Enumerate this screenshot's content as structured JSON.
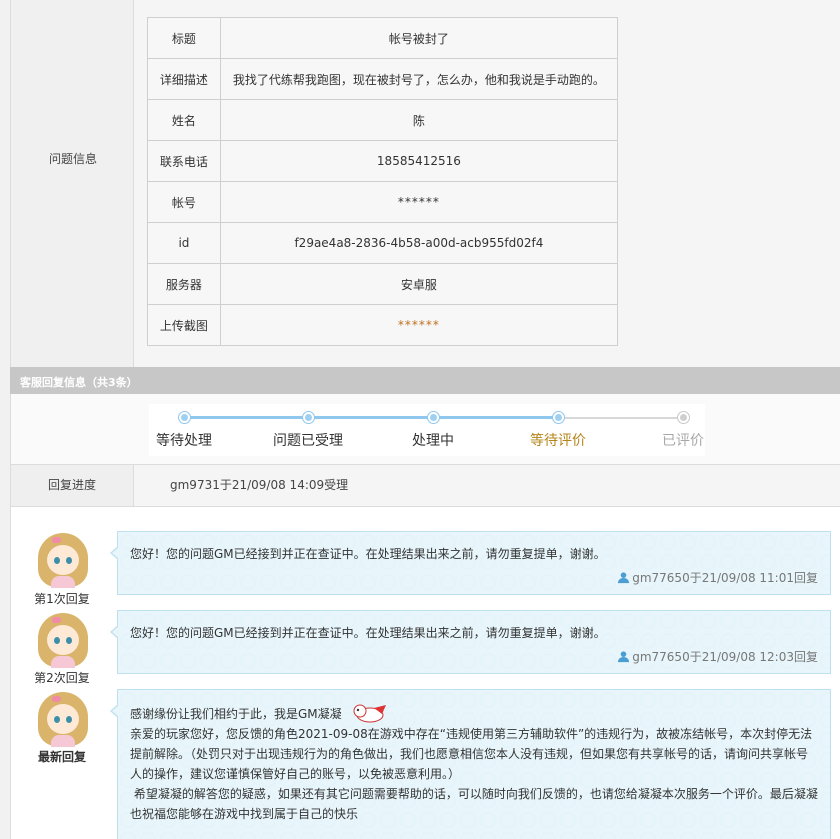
{
  "problem_info": {
    "section_label": "问题信息",
    "rows": [
      {
        "key": "标题",
        "value": "帐号被封了"
      },
      {
        "key": "详细描述",
        "value": "我找了代练帮我跑图，现在被封号了，怎么办，他和我说是手动跑的。"
      },
      {
        "key": "姓名",
        "value": "陈"
      },
      {
        "key": "联系电话",
        "value": "18585412516"
      },
      {
        "key": "帐号",
        "value": "******"
      },
      {
        "key": "id",
        "value": "f29ae4a8-2836-4b58-a00d-acb955fd02f4"
      },
      {
        "key": "服务器",
        "value": "安卓服"
      },
      {
        "key": "上传截图",
        "value": "******"
      }
    ]
  },
  "reply_header": "客服回复信息（共3条）",
  "progress_steps": [
    {
      "label": "等待处理",
      "state": "done"
    },
    {
      "label": "问题已受理",
      "state": "done"
    },
    {
      "label": "处理中",
      "state": "done"
    },
    {
      "label": "等待评价",
      "state": "current"
    },
    {
      "label": "已评价",
      "state": "pending"
    }
  ],
  "reply_progress": {
    "label": "回复进度",
    "value": "gm9731于21/09/08 14:09受理"
  },
  "replies": [
    {
      "label": "第1次回复",
      "message": "您好！您的问题GM已经接到并正在查证中。在处理结果出来之前，请勿重复提单，谢谢。",
      "meta": "gm77650于21/09/08 11:01回复"
    },
    {
      "label": "第2次回复",
      "message": "您好！您的问题GM已经接到并正在查证中。在处理结果出来之前，请勿重复提单，谢谢。",
      "meta": "gm77650于21/09/08 12:03回复"
    },
    {
      "label": "最新回复",
      "lines": [
        "感谢缘份让我们相约于此，我是GM凝凝",
        "亲爱的玩家您好，您反馈的角色2021-09-08在游戏中存在“违规使用第三方辅助软件”的违规行为，故被冻结帐号，本次封停无法提前解除。（处罚只对于出现违规行为的角色做出，我们也愿意相信您本人没有违规，但如果您有共享帐号的话，请询问共享帐号人的操作，建议您谨慎保管好自己的账号，以免被恶意利用。）",
        " 希望凝凝的解答您的疑惑，如果还有其它问题需要帮助的话，可以随时向我们反馈的，也请您给凝凝本次服务一个评价。最后凝凝也祝福您能够在游戏中找到属于自己的快乐"
      ]
    }
  ],
  "colors": {
    "accent_blue": "#8fc7ee",
    "current_step": "#b5841b",
    "pending_step": "#a8a8a8",
    "bubble_bg": "#e8f6fb"
  }
}
